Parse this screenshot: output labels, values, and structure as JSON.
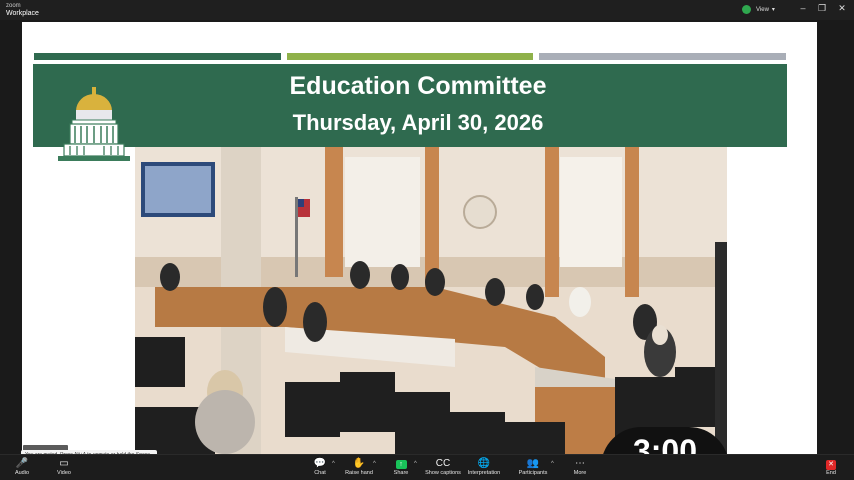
{
  "titlebar": {
    "brand_top": "zoom",
    "brand_bottom": "Workplace",
    "view_label": "View",
    "shield_icon": "shield-check-icon",
    "minimize": "–",
    "restore": "❐",
    "close": "✕"
  },
  "slide": {
    "title": "Education Committee",
    "date": "Thursday, April 30, 2026",
    "accent_colors": [
      "#2f6a4f",
      "#8fb14a",
      "#a9aeb7"
    ],
    "banner_color": "#2f6a4f"
  },
  "timer": {
    "value": "3:00"
  },
  "tooltip": {
    "text": "You are muted. Press Alt+A to unmute or hold the Space bar to temporarily unmute."
  },
  "toolbar": {
    "items": [
      {
        "label": "Audio",
        "icon": "microphone-icon"
      },
      {
        "label": "Video",
        "icon": "video-camera-icon"
      },
      {
        "label": "Chat",
        "icon": "chat-icon"
      },
      {
        "label": "Raise hand",
        "icon": "hand-icon"
      },
      {
        "label": "Share",
        "icon": "share-screen-icon"
      },
      {
        "label": "Show captions",
        "icon": "captions-icon"
      },
      {
        "label": "Interpretation",
        "icon": "globe-icon"
      },
      {
        "label": "Participants",
        "icon": "participants-icon"
      },
      {
        "label": "More",
        "icon": "more-icon"
      },
      {
        "label": "End",
        "icon": "end-icon"
      }
    ]
  }
}
